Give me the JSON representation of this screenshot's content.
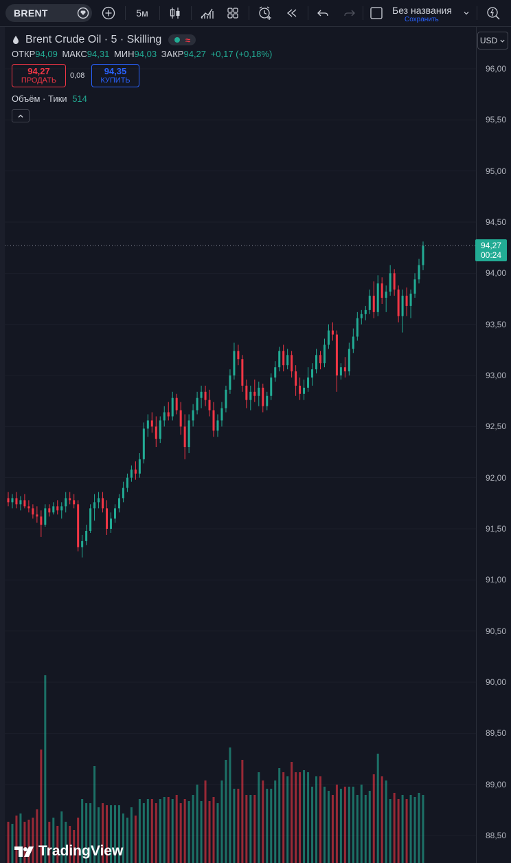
{
  "toolbar": {
    "symbol": "BRENT",
    "interval": "5м",
    "layout_title": "Без названия",
    "layout_subtitle": "Сохранить"
  },
  "legend": {
    "title": "Brent Crude Oil · 5 · Skilling",
    "wave": "≈",
    "open_label": "ОТКР",
    "open": "94,09",
    "high_label": "МАКС",
    "high": "94,31",
    "low_label": "МИН",
    "low": "94,03",
    "close_label": "ЗАКР",
    "close": "94,27",
    "change": "+0,17 (+0,18%)",
    "sell_price": "94,27",
    "sell_label": "ПРОДАТЬ",
    "spread": "0,08",
    "buy_price": "94,35",
    "buy_label": "КУПИТЬ",
    "volume_label": "Объём · Тики",
    "volume_value": "514"
  },
  "currency": "USD",
  "last_price": {
    "value": "94,27",
    "countdown": "00:24"
  },
  "brand": "TradingView",
  "colors": {
    "up": "#22ab94",
    "down": "#f23645",
    "background": "#141722"
  },
  "chart_data": {
    "type": "candlestick",
    "y_axis_ticks": [
      "96,00",
      "95,50",
      "95,00",
      "94,50",
      "94,00",
      "93,50",
      "93,00",
      "92,50",
      "92,00",
      "91,50",
      "91,00",
      "90,50",
      "90,00",
      "89,50",
      "89,00",
      "88,50"
    ],
    "ylim": [
      88.3,
      96.2
    ],
    "last_price": 94.27,
    "ohlc": [
      [
        91.8,
        91.86,
        91.72,
        91.76
      ],
      [
        91.76,
        91.84,
        91.7,
        91.8
      ],
      [
        91.8,
        91.86,
        91.7,
        91.74
      ],
      [
        91.74,
        91.82,
        91.68,
        91.78
      ],
      [
        91.78,
        91.84,
        91.7,
        91.72
      ],
      [
        91.72,
        91.78,
        91.66,
        91.7
      ],
      [
        91.7,
        91.74,
        91.6,
        91.64
      ],
      [
        91.64,
        91.72,
        91.56,
        91.62
      ],
      [
        91.62,
        91.68,
        91.42,
        91.54
      ],
      [
        91.54,
        91.74,
        91.52,
        91.7
      ],
      [
        91.7,
        91.74,
        91.62,
        91.66
      ],
      [
        91.66,
        91.76,
        91.64,
        91.72
      ],
      [
        91.72,
        91.78,
        91.64,
        91.68
      ],
      [
        91.68,
        91.76,
        91.6,
        91.72
      ],
      [
        91.72,
        91.86,
        91.66,
        91.8
      ],
      [
        91.8,
        91.86,
        91.74,
        91.78
      ],
      [
        91.78,
        91.84,
        91.7,
        91.74
      ],
      [
        91.74,
        91.78,
        91.28,
        91.32
      ],
      [
        91.32,
        91.44,
        91.22,
        91.38
      ],
      [
        91.38,
        91.54,
        91.34,
        91.48
      ],
      [
        91.48,
        91.74,
        91.46,
        91.7
      ],
      [
        91.7,
        91.84,
        91.58,
        91.76
      ],
      [
        91.76,
        91.86,
        91.7,
        91.8
      ],
      [
        91.8,
        91.86,
        91.66,
        91.7
      ],
      [
        91.7,
        91.78,
        91.44,
        91.5
      ],
      [
        91.5,
        91.66,
        91.46,
        91.6
      ],
      [
        91.6,
        91.74,
        91.56,
        91.7
      ],
      [
        91.7,
        91.84,
        91.66,
        91.8
      ],
      [
        91.8,
        91.96,
        91.76,
        91.9
      ],
      [
        91.9,
        92.04,
        91.86,
        92.0
      ],
      [
        92.0,
        92.12,
        91.96,
        92.08
      ],
      [
        92.08,
        92.16,
        91.98,
        92.04
      ],
      [
        92.04,
        92.24,
        92.0,
        92.18
      ],
      [
        92.18,
        92.54,
        92.14,
        92.48
      ],
      [
        92.48,
        92.62,
        92.4,
        92.56
      ],
      [
        92.56,
        92.64,
        92.44,
        92.5
      ],
      [
        92.5,
        92.6,
        92.3,
        92.38
      ],
      [
        92.38,
        92.6,
        92.34,
        92.56
      ],
      [
        92.56,
        92.7,
        92.5,
        92.64
      ],
      [
        92.64,
        92.74,
        92.56,
        92.6
      ],
      [
        92.6,
        92.84,
        92.56,
        92.78
      ],
      [
        92.78,
        92.82,
        92.62,
        92.66
      ],
      [
        92.66,
        92.74,
        92.42,
        92.5
      ],
      [
        92.5,
        92.62,
        92.18,
        92.3
      ],
      [
        92.3,
        92.62,
        92.24,
        92.56
      ],
      [
        92.56,
        92.72,
        92.5,
        92.66
      ],
      [
        92.66,
        92.84,
        92.62,
        92.78
      ],
      [
        92.78,
        92.9,
        92.68,
        92.84
      ],
      [
        92.84,
        92.9,
        92.7,
        92.76
      ],
      [
        92.76,
        92.86,
        92.6,
        92.66
      ],
      [
        92.66,
        92.74,
        92.4,
        92.46
      ],
      [
        92.46,
        92.62,
        92.4,
        92.56
      ],
      [
        92.56,
        92.74,
        92.5,
        92.68
      ],
      [
        92.68,
        92.9,
        92.64,
        92.86
      ],
      [
        92.86,
        93.06,
        92.82,
        93.0
      ],
      [
        93.0,
        93.32,
        92.96,
        93.24
      ],
      [
        93.24,
        93.3,
        93.1,
        93.16
      ],
      [
        93.16,
        93.2,
        92.84,
        92.9
      ],
      [
        92.9,
        92.96,
        92.68,
        92.76
      ],
      [
        92.76,
        92.9,
        92.66,
        92.84
      ],
      [
        92.84,
        92.96,
        92.74,
        92.8
      ],
      [
        92.8,
        92.94,
        92.7,
        92.88
      ],
      [
        92.88,
        92.92,
        92.64,
        92.7
      ],
      [
        92.7,
        92.84,
        92.66,
        92.8
      ],
      [
        92.8,
        93.02,
        92.76,
        92.98
      ],
      [
        92.98,
        93.14,
        92.94,
        93.08
      ],
      [
        93.08,
        93.28,
        93.04,
        93.24
      ],
      [
        93.24,
        93.3,
        93.04,
        93.1
      ],
      [
        93.1,
        93.26,
        93.06,
        93.2
      ],
      [
        93.2,
        93.24,
        92.98,
        93.04
      ],
      [
        93.04,
        93.1,
        92.8,
        92.9
      ],
      [
        92.9,
        92.98,
        92.76,
        92.82
      ],
      [
        92.82,
        92.96,
        92.76,
        92.88
      ],
      [
        92.88,
        93.08,
        92.84,
        92.98
      ],
      [
        92.98,
        93.12,
        92.9,
        93.06
      ],
      [
        93.06,
        93.26,
        93.02,
        93.2
      ],
      [
        93.2,
        93.24,
        93.06,
        93.12
      ],
      [
        93.12,
        93.36,
        93.08,
        93.3
      ],
      [
        93.3,
        93.5,
        93.26,
        93.44
      ],
      [
        93.44,
        93.52,
        93.34,
        93.4
      ],
      [
        93.4,
        93.44,
        92.84,
        93.0
      ],
      [
        93.0,
        93.12,
        92.96,
        93.08
      ],
      [
        93.08,
        93.18,
        92.98,
        93.04
      ],
      [
        93.04,
        93.32,
        93.0,
        93.26
      ],
      [
        93.26,
        93.46,
        93.22,
        93.38
      ],
      [
        93.38,
        93.62,
        93.34,
        93.56
      ],
      [
        93.56,
        93.64,
        93.5,
        93.6
      ],
      [
        93.6,
        93.68,
        93.54,
        93.64
      ],
      [
        93.64,
        93.84,
        93.6,
        93.78
      ],
      [
        93.78,
        93.92,
        93.56,
        93.62
      ],
      [
        93.62,
        93.98,
        93.58,
        93.9
      ],
      [
        93.9,
        93.96,
        93.7,
        93.76
      ],
      [
        93.76,
        93.88,
        93.62,
        93.82
      ],
      [
        93.82,
        94.08,
        93.78,
        94.0
      ],
      [
        94.0,
        94.04,
        93.78,
        93.84
      ],
      [
        93.84,
        93.88,
        93.52,
        93.58
      ],
      [
        93.58,
        93.84,
        93.42,
        93.78
      ],
      [
        93.78,
        93.86,
        93.58,
        93.68
      ],
      [
        93.68,
        93.84,
        93.56,
        93.8
      ],
      [
        93.8,
        94.0,
        93.76,
        93.94
      ],
      [
        93.94,
        94.14,
        93.9,
        94.08
      ],
      [
        94.08,
        94.31,
        94.03,
        94.27
      ]
    ],
    "volume": [
      200,
      190,
      230,
      240,
      200,
      210,
      220,
      260,
      550,
      910,
      200,
      220,
      180,
      250,
      200,
      180,
      160,
      220,
      310,
      290,
      290,
      470,
      270,
      290,
      280,
      280,
      280,
      280,
      240,
      220,
      270,
      230,
      310,
      290,
      310,
      310,
      290,
      310,
      320,
      320,
      310,
      330,
      290,
      310,
      300,
      330,
      380,
      300,
      400,
      300,
      320,
      290,
      400,
      500,
      560,
      360,
      360,
      500,
      330,
      330,
      330,
      440,
      400,
      360,
      360,
      400,
      460,
      440,
      420,
      490,
      440,
      440,
      450,
      440,
      370,
      420,
      420,
      370,
      350,
      330,
      380,
      360,
      370,
      370,
      370,
      330,
      380,
      330,
      350,
      430,
      530,
      420,
      400,
      310,
      340,
      310,
      330,
      310,
      330,
      320,
      340,
      330,
      340,
      360,
      350,
      310
    ]
  }
}
